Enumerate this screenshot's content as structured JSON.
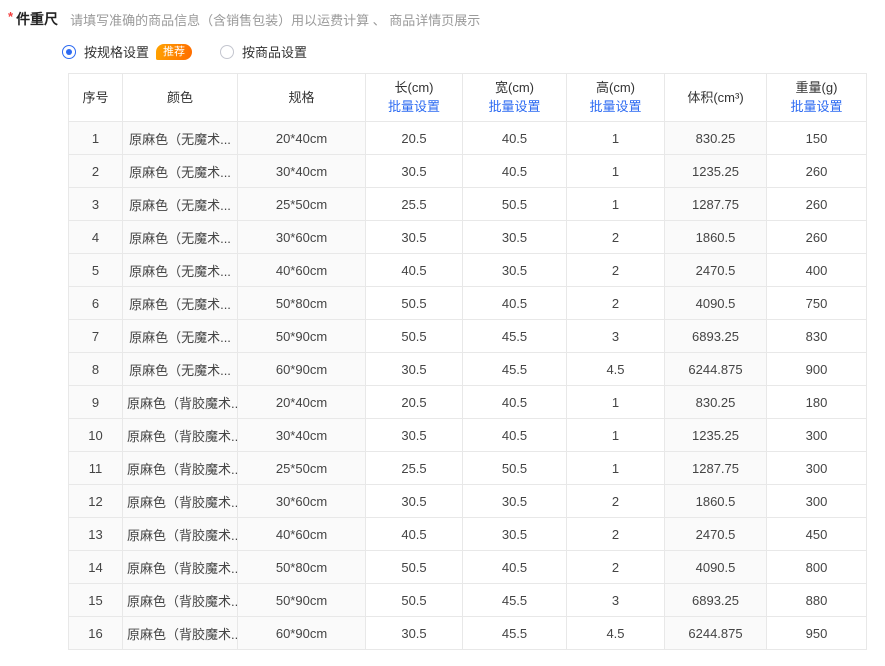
{
  "field": {
    "required_mark": "*",
    "label": "件重尺",
    "description": "请填写准确的商品信息（含销售包装）用以运费计算 、 商品详情页展示"
  },
  "mode": {
    "options": [
      {
        "label": "按规格设置",
        "selected": true,
        "badge": "推荐"
      },
      {
        "label": "按商品设置",
        "selected": false
      }
    ]
  },
  "table": {
    "batch_set_label": "批量设置",
    "columns": [
      {
        "key": "index",
        "label": "序号",
        "batch": false,
        "editable": false
      },
      {
        "key": "color",
        "label": "颜色",
        "batch": false,
        "editable": false
      },
      {
        "key": "spec",
        "label": "规格",
        "batch": false,
        "editable": false
      },
      {
        "key": "length",
        "label": "长(cm)",
        "batch": true,
        "editable": true
      },
      {
        "key": "width",
        "label": "宽(cm)",
        "batch": true,
        "editable": true
      },
      {
        "key": "height",
        "label": "高(cm)",
        "batch": true,
        "editable": true
      },
      {
        "key": "volume",
        "label": "体积(cm³)",
        "batch": false,
        "editable": false
      },
      {
        "key": "weight",
        "label": "重量(g)",
        "batch": true,
        "editable": true
      }
    ],
    "rows": [
      {
        "index": "1",
        "color": "原麻色（无魔术...",
        "spec": "20*40cm",
        "length": "20.5",
        "width": "40.5",
        "height": "1",
        "volume": "830.25",
        "weight": "150"
      },
      {
        "index": "2",
        "color": "原麻色（无魔术...",
        "spec": "30*40cm",
        "length": "30.5",
        "width": "40.5",
        "height": "1",
        "volume": "1235.25",
        "weight": "260"
      },
      {
        "index": "3",
        "color": "原麻色（无魔术...",
        "spec": "25*50cm",
        "length": "25.5",
        "width": "50.5",
        "height": "1",
        "volume": "1287.75",
        "weight": "260"
      },
      {
        "index": "4",
        "color": "原麻色（无魔术...",
        "spec": "30*60cm",
        "length": "30.5",
        "width": "30.5",
        "height": "2",
        "volume": "1860.5",
        "weight": "260"
      },
      {
        "index": "5",
        "color": "原麻色（无魔术...",
        "spec": "40*60cm",
        "length": "40.5",
        "width": "30.5",
        "height": "2",
        "volume": "2470.5",
        "weight": "400"
      },
      {
        "index": "6",
        "color": "原麻色（无魔术...",
        "spec": "50*80cm",
        "length": "50.5",
        "width": "40.5",
        "height": "2",
        "volume": "4090.5",
        "weight": "750"
      },
      {
        "index": "7",
        "color": "原麻色（无魔术...",
        "spec": "50*90cm",
        "length": "50.5",
        "width": "45.5",
        "height": "3",
        "volume": "6893.25",
        "weight": "830"
      },
      {
        "index": "8",
        "color": "原麻色（无魔术...",
        "spec": "60*90cm",
        "length": "30.5",
        "width": "45.5",
        "height": "4.5",
        "volume": "6244.875",
        "weight": "900"
      },
      {
        "index": "9",
        "color": "原麻色（背胶魔术...",
        "spec": "20*40cm",
        "length": "20.5",
        "width": "40.5",
        "height": "1",
        "volume": "830.25",
        "weight": "180"
      },
      {
        "index": "10",
        "color": "原麻色（背胶魔术...",
        "spec": "30*40cm",
        "length": "30.5",
        "width": "40.5",
        "height": "1",
        "volume": "1235.25",
        "weight": "300"
      },
      {
        "index": "11",
        "color": "原麻色（背胶魔术...",
        "spec": "25*50cm",
        "length": "25.5",
        "width": "50.5",
        "height": "1",
        "volume": "1287.75",
        "weight": "300"
      },
      {
        "index": "12",
        "color": "原麻色（背胶魔术...",
        "spec": "30*60cm",
        "length": "30.5",
        "width": "30.5",
        "height": "2",
        "volume": "1860.5",
        "weight": "300"
      },
      {
        "index": "13",
        "color": "原麻色（背胶魔术...",
        "spec": "40*60cm",
        "length": "40.5",
        "width": "30.5",
        "height": "2",
        "volume": "2470.5",
        "weight": "450"
      },
      {
        "index": "14",
        "color": "原麻色（背胶魔术...",
        "spec": "50*80cm",
        "length": "50.5",
        "width": "40.5",
        "height": "2",
        "volume": "4090.5",
        "weight": "800"
      },
      {
        "index": "15",
        "color": "原麻色（背胶魔术...",
        "spec": "50*90cm",
        "length": "50.5",
        "width": "45.5",
        "height": "3",
        "volume": "6893.25",
        "weight": "880"
      },
      {
        "index": "16",
        "color": "原麻色（背胶魔术...",
        "spec": "60*90cm",
        "length": "30.5",
        "width": "45.5",
        "height": "4.5",
        "volume": "6244.875",
        "weight": "950"
      }
    ]
  },
  "colors": {
    "accent_blue": "#2d6bf2",
    "badge_orange_start": "#ffa300",
    "badge_orange_end": "#ff6c00",
    "required_red": "#f23c3c",
    "border_gray": "#e8e8e8",
    "readonly_cell_bg": "#fafafa",
    "desc_gray": "#9a9a9a"
  }
}
